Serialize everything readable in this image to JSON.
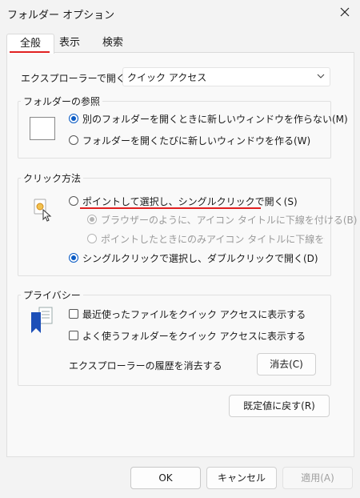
{
  "window": {
    "title": "フォルダー オプション"
  },
  "tabs": [
    {
      "label": "全般",
      "active": true
    },
    {
      "label": "表示",
      "active": false
    },
    {
      "label": "検索",
      "active": false
    }
  ],
  "explorer_open": {
    "label": "エクスプローラーで開く:",
    "selected": "クイック アクセス"
  },
  "browse_folders": {
    "legend": "フォルダーの参照",
    "options": [
      {
        "label": "別のフォルダーを開くときに新しいウィンドウを作らない(M)",
        "selected": true
      },
      {
        "label": "フォルダーを開くたびに新しいウィンドウを作る(W)",
        "selected": false
      }
    ]
  },
  "click_method": {
    "legend": "クリック方法",
    "options": [
      {
        "label": "ポイントして選択し、シングルクリックで開く(S)",
        "selected": false,
        "enabled": true,
        "highlighted": true
      },
      {
        "label": "ブラウザーのように、アイコン タイトルに下線を付ける(B)",
        "selected": true,
        "enabled": false
      },
      {
        "label": "ポイントしたときにのみアイコン タイトルに下線を付ける(",
        "selected": false,
        "enabled": false
      },
      {
        "label": "シングルクリックで選択し、ダブルクリックで開く(D)",
        "selected": true,
        "enabled": true
      }
    ]
  },
  "privacy": {
    "legend": "プライバシー",
    "checkboxes": [
      {
        "label": "最近使ったファイルをクイック アクセスに表示する",
        "checked": false
      },
      {
        "label": "よく使うフォルダーをクイック アクセスに表示する",
        "checked": false
      }
    ],
    "clear_history_label": "エクスプローラーの履歴を消去する",
    "clear_button": "消去(C)"
  },
  "restore_defaults_button": "既定値に戻す(R)",
  "footer": {
    "ok": "OK",
    "cancel": "キャンセル",
    "apply": "適用(A)"
  },
  "colors": {
    "accent": "#0a5bc4",
    "highlight_underline": "#e02020"
  }
}
